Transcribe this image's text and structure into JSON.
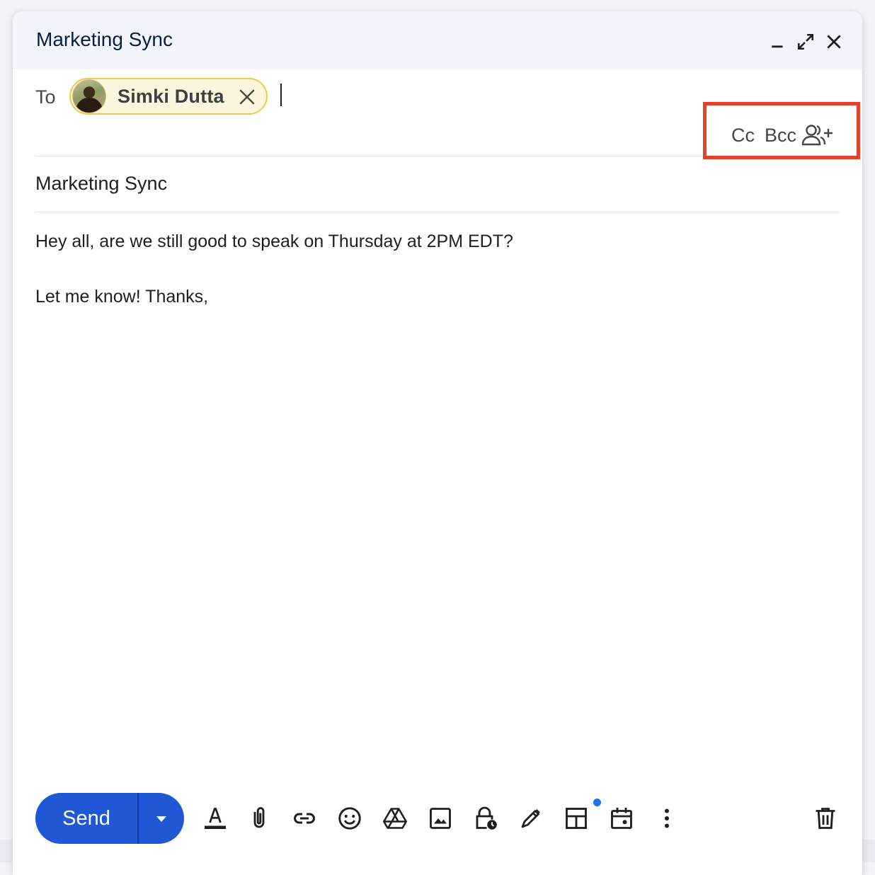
{
  "compose": {
    "title": "Marketing Sync",
    "controls": {
      "minimize": "minimize-icon",
      "expand": "open-in-full-icon",
      "close": "close-icon"
    }
  },
  "recipients": {
    "to_label": "To",
    "chips": [
      {
        "name": "Simki Dutta",
        "avatar": "avatar-photo"
      }
    ],
    "cc_label": "Cc",
    "bcc_label": "Bcc"
  },
  "subject": "Marketing Sync",
  "body": {
    "lines": [
      "Hey all, are we still good to speak on Thursday at 2PM EDT?",
      "Let me know! Thanks,"
    ]
  },
  "toolbar": {
    "send_label": "Send",
    "icons": [
      "formatting-icon",
      "attach-icon",
      "link-icon",
      "emoji-icon",
      "drive-icon",
      "photo-icon",
      "confidential-mode-icon",
      "signature-icon",
      "layouts-icon",
      "schedule-icon",
      "more-options-icon",
      "discard-icon"
    ]
  },
  "colors": {
    "accent": "#1f57d4",
    "highlight_box": "#e8402b",
    "chip_border": "#f1c94a"
  }
}
